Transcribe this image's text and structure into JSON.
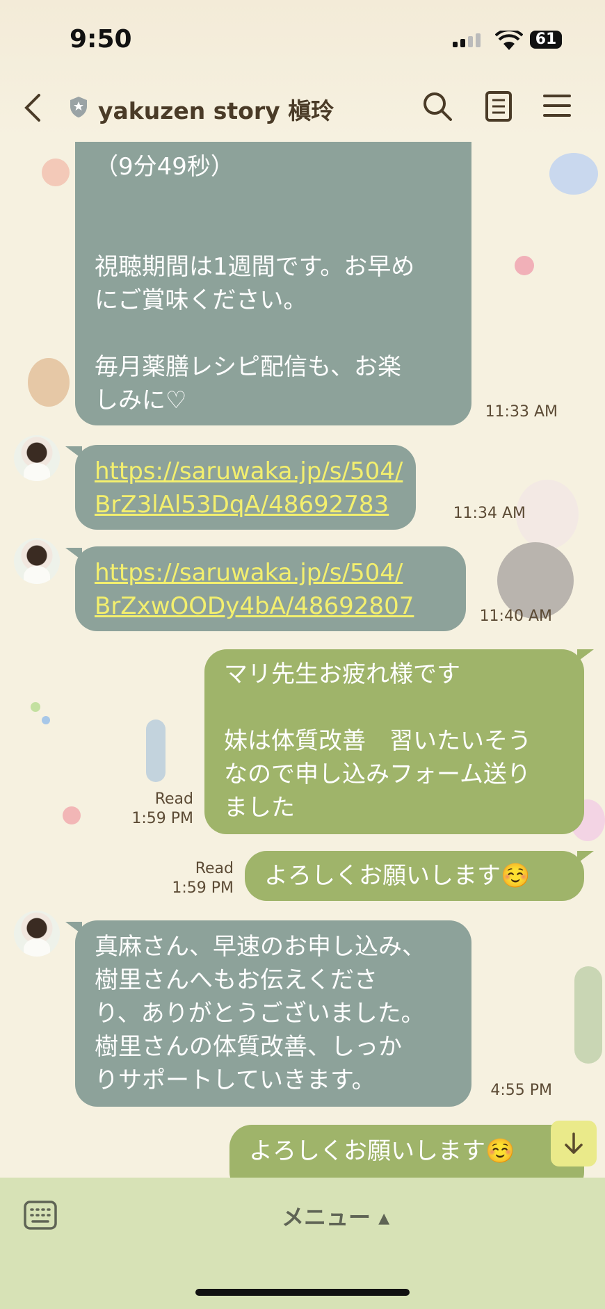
{
  "status_bar": {
    "time": "9:50",
    "battery": "61"
  },
  "header": {
    "title": "yakuzen story 槇玲"
  },
  "messages": {
    "m1": {
      "text": "（9分49秒）\n\n\n視聴期間は1週間です。お早め\nにご賞味ください。\n\n毎月薬膳レシピ配信も、お楽\nしみに♡",
      "time": "11:33 AM"
    },
    "m2": {
      "link": "https://saruwaka.jp/s/504/\nBrZ3lAl53DqA/48692783",
      "time": "11:34 AM"
    },
    "m3": {
      "link": "https://saruwaka.jp/s/504/\nBrZxwOODy4bA/48692807",
      "time": "11:40 AM"
    },
    "m4": {
      "text": "マリ先生お疲れ様です\n\n妹は体質改善　習いたいそう\nなので申し込みフォーム送り\nました",
      "read": "Read",
      "time": "1:59 PM"
    },
    "m5": {
      "text": "よろしくお願いします☺️",
      "read": "Read",
      "time": "1:59 PM"
    },
    "m6": {
      "text": "真麻さん、早速のお申し込み、\n樹里さんへもお伝えくださ\nり、ありがとうございました。\n樹里さんの体質改善、しっか\nりサポートしていきます。",
      "time": "4:55 PM"
    },
    "m7": {
      "text": "よろしくお願いします☺️"
    }
  },
  "footer": {
    "menu_label": "メニュー ▴"
  },
  "icons": {
    "back": "chevron-left-icon",
    "shield": "shield-icon",
    "search": "search-icon",
    "notes": "notes-icon",
    "menu": "hamburger-icon",
    "keyboard": "keyboard-icon",
    "scroll_down": "arrow-down-icon"
  }
}
